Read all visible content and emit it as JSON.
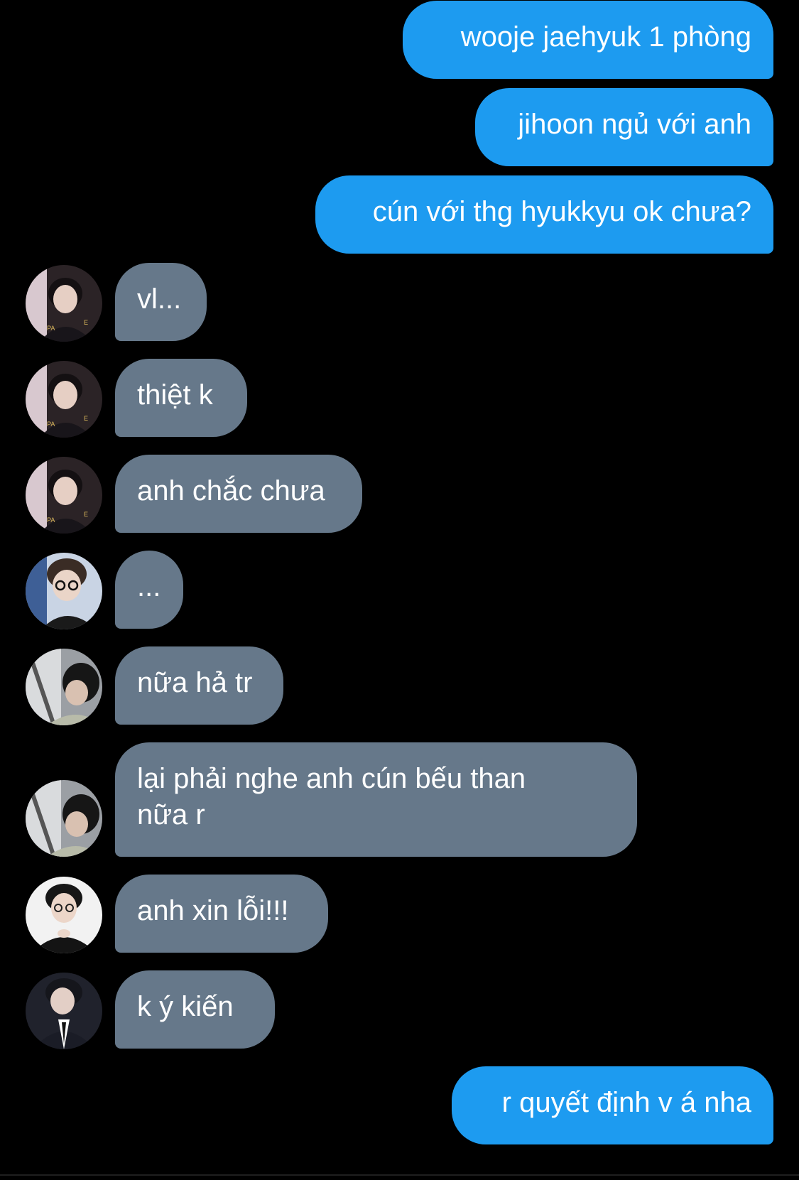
{
  "messages": [
    {
      "id": "m1",
      "direction": "outgoing",
      "text": "wooje jaehyuk 1 phòng"
    },
    {
      "id": "m2",
      "direction": "outgoing",
      "text": "jihoon ngủ với anh"
    },
    {
      "id": "m3",
      "direction": "outgoing",
      "text": "cún với thg hyukkyu ok chưa?"
    },
    {
      "id": "m4",
      "direction": "incoming",
      "avatar": "avatar-a",
      "text": "vl..."
    },
    {
      "id": "m5",
      "direction": "incoming",
      "avatar": "avatar-a",
      "text": "thiệt k"
    },
    {
      "id": "m6",
      "direction": "incoming",
      "avatar": "avatar-a",
      "text": "anh chắc chưa"
    },
    {
      "id": "m7",
      "direction": "incoming",
      "avatar": "avatar-b",
      "text": "..."
    },
    {
      "id": "m8",
      "direction": "incoming",
      "avatar": "avatar-c",
      "text": "nữa hả tr"
    },
    {
      "id": "m9",
      "direction": "incoming",
      "avatar": "avatar-c",
      "text": "lại phải nghe anh cún bếu than nữa r"
    },
    {
      "id": "m10",
      "direction": "incoming",
      "avatar": "avatar-d",
      "text": "anh xin lỗi!!!"
    },
    {
      "id": "m11",
      "direction": "incoming",
      "avatar": "avatar-e",
      "text": "k ý kiến"
    },
    {
      "id": "m12",
      "direction": "outgoing",
      "text": "r quyết định v á nha"
    }
  ],
  "colors": {
    "background": "#000000",
    "outgoing_bubble": "#1d9bf0",
    "incoming_bubble": "#66788a",
    "text": "#ffffff"
  }
}
